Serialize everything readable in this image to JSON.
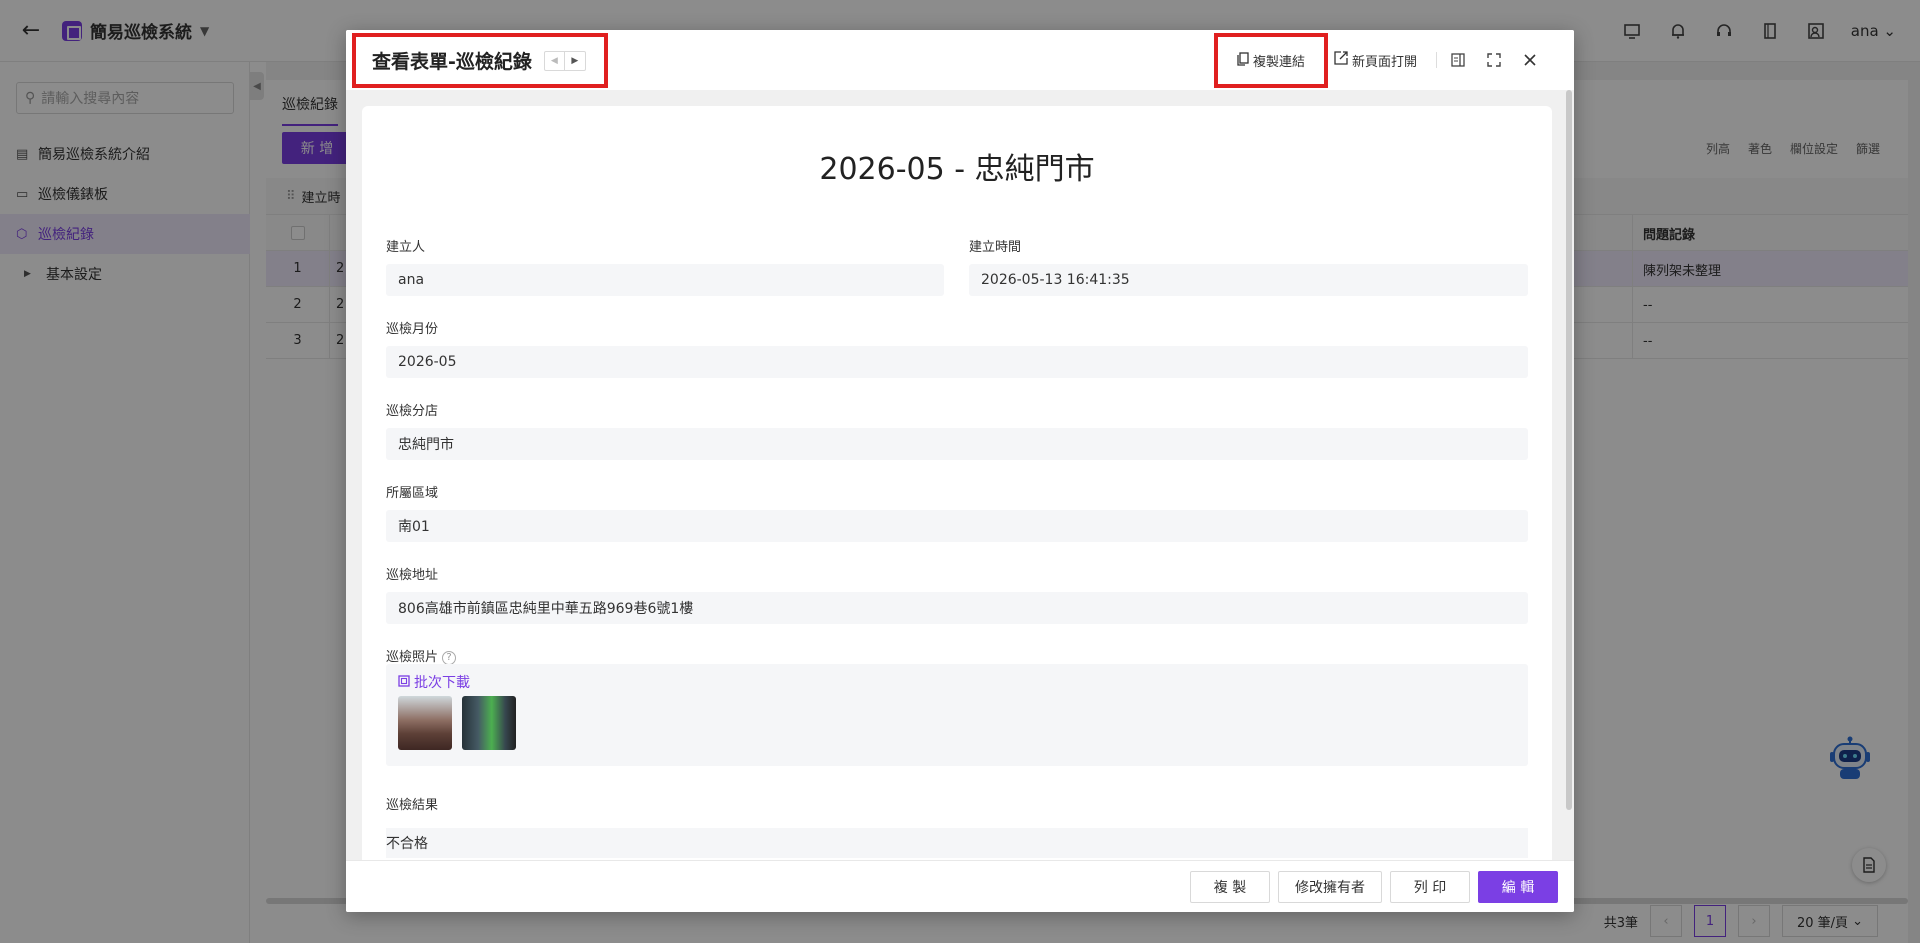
{
  "app": {
    "title": "簡易巡檢系統",
    "user": "ana"
  },
  "sidebar": {
    "search_placeholder": "請輸入搜尋內容",
    "items": [
      {
        "label": "簡易巡檢系統介紹",
        "icon": "table-icon"
      },
      {
        "label": "巡檢儀錶板",
        "icon": "dashboard-icon"
      },
      {
        "label": "巡檢紀錄",
        "icon": "cube-icon",
        "active": true
      },
      {
        "label": "基本設定",
        "icon": "caret-right-icon"
      }
    ]
  },
  "main": {
    "tab": "巡檢紀錄",
    "new_button": "新 增",
    "tools": [
      "列高",
      "著色",
      "欄位設定",
      "篩選"
    ],
    "filter_label": "建立時",
    "rows": [
      {
        "num": "1",
        "col2": "2",
        "issue": "陳列架未整理"
      },
      {
        "num": "2",
        "col2": "2",
        "issue": "--"
      },
      {
        "num": "3",
        "col2": "2",
        "issue": "--"
      }
    ],
    "issue_header": "問題記錄",
    "total": "共3筆",
    "page": "1",
    "page_size": "20 筆/頁"
  },
  "modal": {
    "title": "查看表單-巡檢紀錄",
    "copy_link": "複製連結",
    "open_new_page": "新頁面打開",
    "form_title": "2026-05 - 忠純門市",
    "fields": {
      "creator_label": "建立人",
      "creator_value": "ana",
      "created_time_label": "建立時間",
      "created_time_value": "2026-05-13 16:41:35",
      "month_label": "巡檢月份",
      "month_value": "2026-05",
      "branch_label": "巡檢分店",
      "branch_value": "忠純門市",
      "region_label": "所屬區域",
      "region_value": "南01",
      "address_label": "巡檢地址",
      "address_value": "806高雄市前鎮區忠純里中華五路969巷6號1樓",
      "photos_label": "巡檢照片",
      "batch_download": "批次下載",
      "result_label": "巡檢結果",
      "result_value": "不合格"
    },
    "footer": {
      "copy": "複 製",
      "change_owner": "修改擁有者",
      "print": "列 印",
      "edit": "編 輯"
    }
  },
  "colors": {
    "accent": "#7b3fe4",
    "highlight_border": "#e02020"
  }
}
